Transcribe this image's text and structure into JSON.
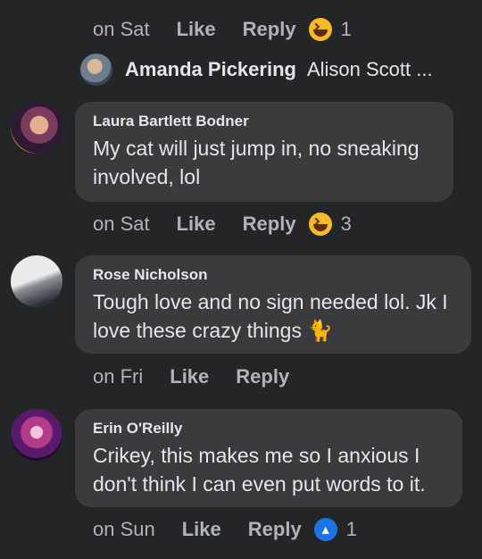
{
  "top_meta": {
    "time": "on Sat",
    "like": "Like",
    "reply": "Reply",
    "reaction_count": "1",
    "reaction_icon": "haha-icon"
  },
  "reply_preview": {
    "name": "Amanda Pickering",
    "snippet": "Alison Scott ..."
  },
  "comments": [
    {
      "author": "Laura Bartlett Bodner",
      "text": "My cat will just jump in, no sneaking involved, lol",
      "time": "on Sat",
      "like": "Like",
      "reply": "Reply",
      "reaction_icon": "haha-icon",
      "reaction_count": "3"
    },
    {
      "author": "Rose Nicholson",
      "text": "Tough love and no sign needed lol. Jk I love these crazy things 🐈",
      "time": "on Fri",
      "like": "Like",
      "reply": "Reply"
    },
    {
      "author": "Erin O'Reilly",
      "text": "Crikey, this makes me so I anxious I don't think I can even put words to it.",
      "time": "on Sun",
      "like": "Like",
      "reply": "Reply",
      "reaction_icon": "like-icon",
      "reaction_count": "1"
    }
  ],
  "colors": {
    "background": "#242526",
    "bubble": "#3a3b3c",
    "meta_text": "#b0b3b8",
    "like_blue": "#1b74e4",
    "haha_yellow": "#f7b928"
  }
}
